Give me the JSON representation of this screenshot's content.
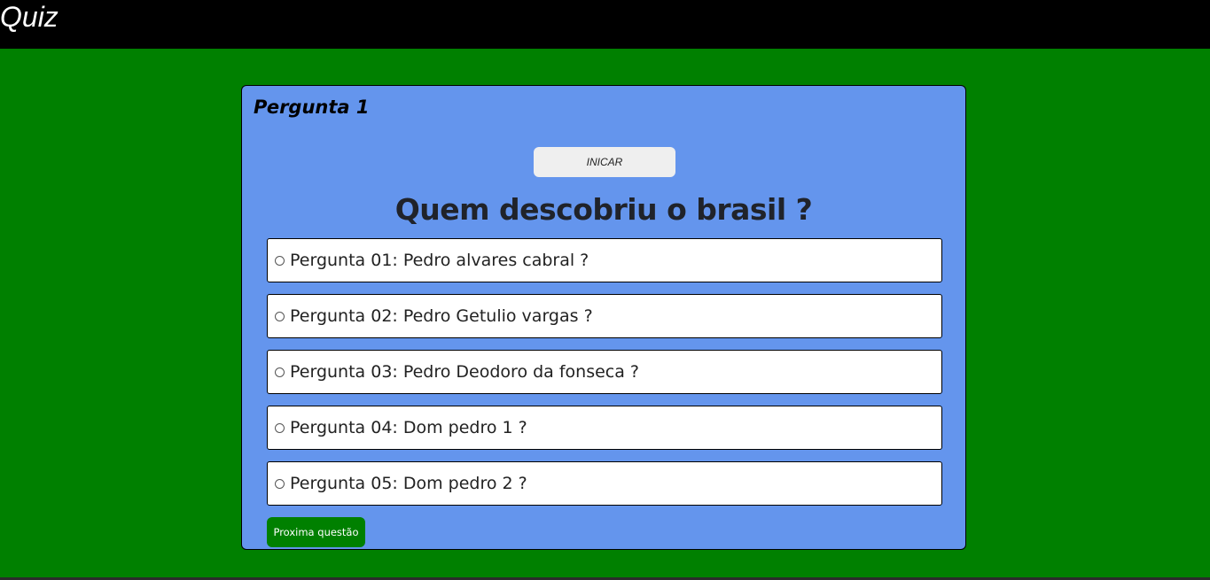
{
  "header": {
    "title": "Quiz"
  },
  "quiz": {
    "question_number": "Pergunta 1",
    "start_label": "INICAR",
    "question": "Quem descobriu o brasil ?",
    "options": [
      {
        "label": "Pergunta 01: Pedro alvares cabral ?"
      },
      {
        "label": "Pergunta 02: Pedro Getulio vargas ?"
      },
      {
        "label": "Pergunta 03: Pedro Deodoro da fonseca ?"
      },
      {
        "label": "Pergunta 04: Dom pedro 1 ?"
      },
      {
        "label": "Pergunta 05: Dom pedro 2 ?"
      }
    ],
    "next_label": "Proxima questão"
  },
  "colors": {
    "background": "#008000",
    "header": "#000000",
    "card": "#6495ed",
    "option": "#ffffff",
    "next_button": "#008000",
    "start_button": "#efefef"
  }
}
